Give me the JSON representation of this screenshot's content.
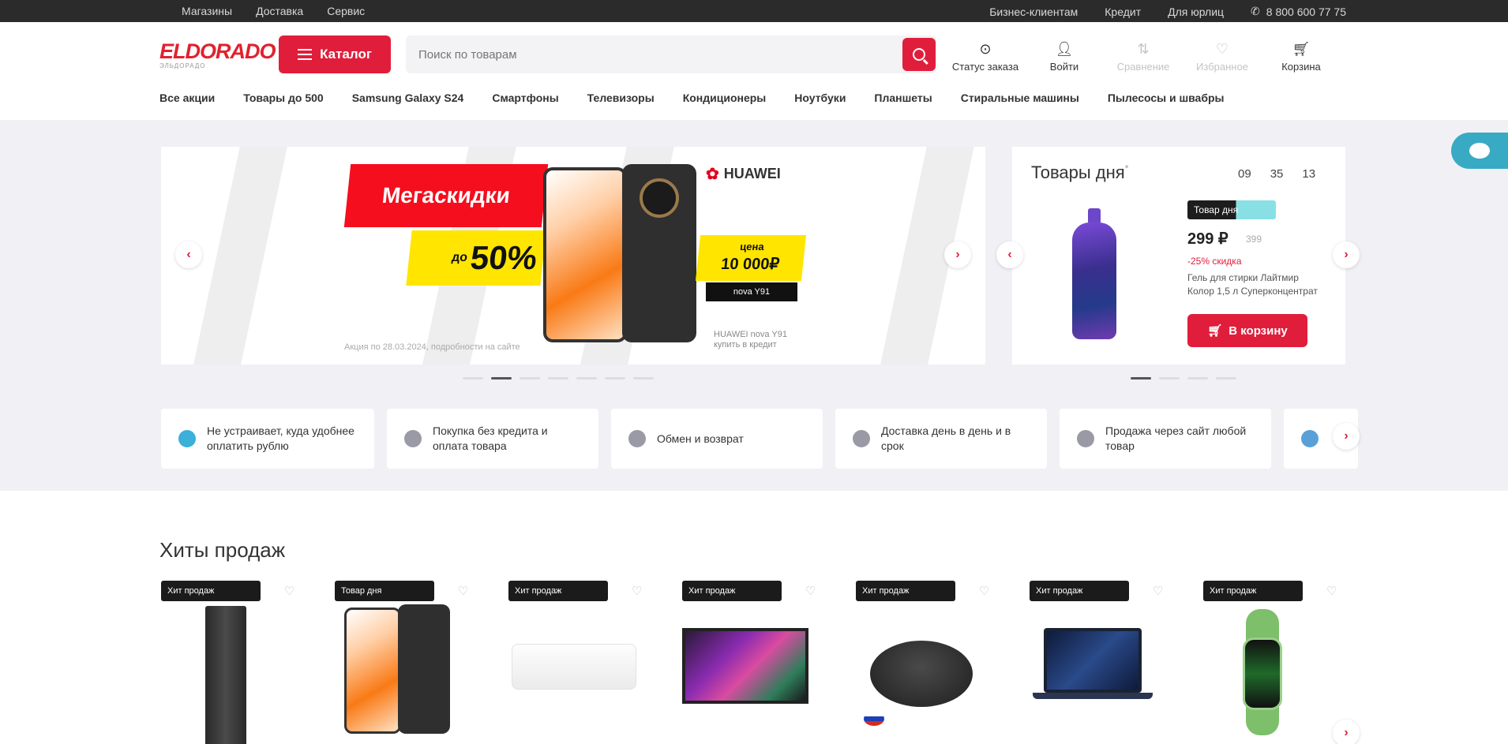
{
  "topbar": {
    "left_links": [
      "Магазины",
      "Доставка",
      "Сервис"
    ],
    "right_links": [
      "Бизнес-клиентам",
      "Кредит",
      "Для юрлиц"
    ],
    "phone": "8 800 600 77 75"
  },
  "header": {
    "logo": "ELDORADO",
    "logo_sub": "ЭЛЬДОРАДО",
    "catalog_button": "Каталог",
    "search_placeholder": "Поиск по товарам",
    "icons": [
      {
        "icon": "pin-icon",
        "label": "Статус заказа"
      },
      {
        "icon": "user-icon",
        "label": "Войти"
      },
      {
        "icon": "compare-icon",
        "label": "Сравнение"
      },
      {
        "icon": "heart-icon",
        "label": "Избранное"
      },
      {
        "icon": "cart-icon",
        "label": "Корзина"
      }
    ],
    "nav": [
      "Все акции",
      "Товары до 500",
      "Samsung Galaxy S24",
      "Смартфоны",
      "Телевизоры",
      "Кондиционеры",
      "Ноутбуки",
      "Планшеты",
      "Стиральные машины",
      "Пылесосы и швабры"
    ]
  },
  "banner": {
    "promo_title": "Мегаскидки",
    "promo_discount": "50%",
    "promo_discount_prefix": "до",
    "brand": "HUAWEI",
    "price_prefix": "цена",
    "price": "10 000₽",
    "chip": "nova Y91",
    "fine_print": "Акция по 28.03.2024, подробности на сайте",
    "legal": "HUAWEI nova Y91 купить в кредит",
    "accent": "#e01e3c",
    "yellow": "#ffe500",
    "active_slide": 2
  },
  "product_of_day": {
    "title": "Товары дня",
    "title_mark": "*",
    "timer": [
      "09",
      "35",
      "13"
    ],
    "badge": "Товар дня",
    "price": "299 ₽",
    "old_price": "399",
    "discount": "-25% скидка",
    "name": "Гель для стирки Лайтмир Колор 1,5 л Суперконцентрат",
    "buy_button": "В корзину"
  },
  "services": [
    "Не устраивает, куда удобнее оплатить рублю",
    "Покупка без кредита и оплата товара",
    "Обмен и возврат",
    "Доставка день в день и в срок",
    "Продажа через сайт любой товар"
  ],
  "hits": {
    "title": "Хиты продаж",
    "cards": [
      {
        "badge": "Хит продаж",
        "product": "refrigerator"
      },
      {
        "badge": "Товар дня",
        "product": "smartphone"
      },
      {
        "badge": "Хит продаж",
        "product": "air-conditioner"
      },
      {
        "badge": "Хит продаж",
        "product": "tv"
      },
      {
        "badge": "Хит продаж",
        "product": "robot-vacuum"
      },
      {
        "badge": "Хит продаж",
        "product": "laptop"
      },
      {
        "badge": "Хит продаж",
        "product": "smartwatch"
      }
    ]
  }
}
